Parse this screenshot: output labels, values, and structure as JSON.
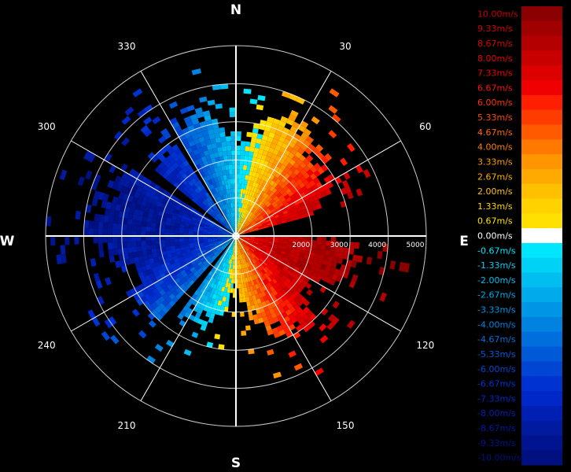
{
  "chart_data": {
    "type": "radial-velocity-ppi",
    "cardinals": [
      "N",
      "E",
      "S",
      "W"
    ],
    "azimuth_labels": [
      "30",
      "60",
      "120",
      "150",
      "210",
      "240",
      "300",
      "330"
    ],
    "azimuth_label_angles": [
      30,
      60,
      120,
      150,
      210,
      240,
      300,
      330
    ],
    "range_rings": [
      1000,
      2000,
      3000,
      4000,
      5000
    ],
    "range_labels": [
      "2000",
      "3000",
      "4000",
      "5000"
    ],
    "range_label_values": [
      2000,
      3000,
      4000,
      5000
    ],
    "max_range": 5000,
    "velocity_range": [
      -10.0,
      10.0
    ],
    "colorbar": {
      "labels": [
        "10.00m/s",
        "9.33m/s",
        "8.67m/s",
        "8.00m/s",
        "7.33m/s",
        "6.67m/s",
        "6.00m/s",
        "5.33m/s",
        "4.67m/s",
        "4.00m/s",
        "3.33m/s",
        "2.67m/s",
        "2.00m/s",
        "1.33m/s",
        "0.67m/s",
        "0.00m/s",
        "-0.67m/s",
        "-1.33m/s",
        "-2.00m/s",
        "-2.67m/s",
        "-3.33m/s",
        "-4.00m/s",
        "-4.67m/s",
        "-5.33m/s",
        "-6.00m/s",
        "-6.67m/s",
        "-7.33m/s",
        "-8.00m/s",
        "-8.67m/s",
        "-9.33m/s",
        "-10.00m/s"
      ],
      "colors": [
        "#8b0000",
        "#a00000",
        "#b40000",
        "#c80000",
        "#dc0000",
        "#f00000",
        "#ff1e00",
        "#ff3c00",
        "#ff5a00",
        "#ff7800",
        "#ff9600",
        "#ffaa00",
        "#ffc000",
        "#ffd200",
        "#ffe000",
        "#ffffff",
        "#00e6ff",
        "#00d2f5",
        "#00bef0",
        "#00aaeb",
        "#0096e6",
        "#0082e1",
        "#006edc",
        "#005ad7",
        "#0046d2",
        "#0032d2",
        "#0028c8",
        "#0020b4",
        "#001aa0",
        "#001490",
        "#001080"
      ],
      "label_colors": [
        "#c80000",
        "#d00000",
        "#dc0000",
        "#e60000",
        "#f00000",
        "#ff1010",
        "#ff3000",
        "#ff4a00",
        "#ff6600",
        "#ff8000",
        "#ff9c00",
        "#ffb000",
        "#ffc400",
        "#ffd400",
        "#ffe400",
        "#ffffff",
        "#00e6ff",
        "#00d2f5",
        "#00bef0",
        "#00aaeb",
        "#0096e6",
        "#0082e1",
        "#006edc",
        "#005ad7",
        "#0046d2",
        "#0032d2",
        "#0028c8",
        "#0020b4",
        "#001aa0",
        "#001490",
        "#001080"
      ]
    }
  }
}
